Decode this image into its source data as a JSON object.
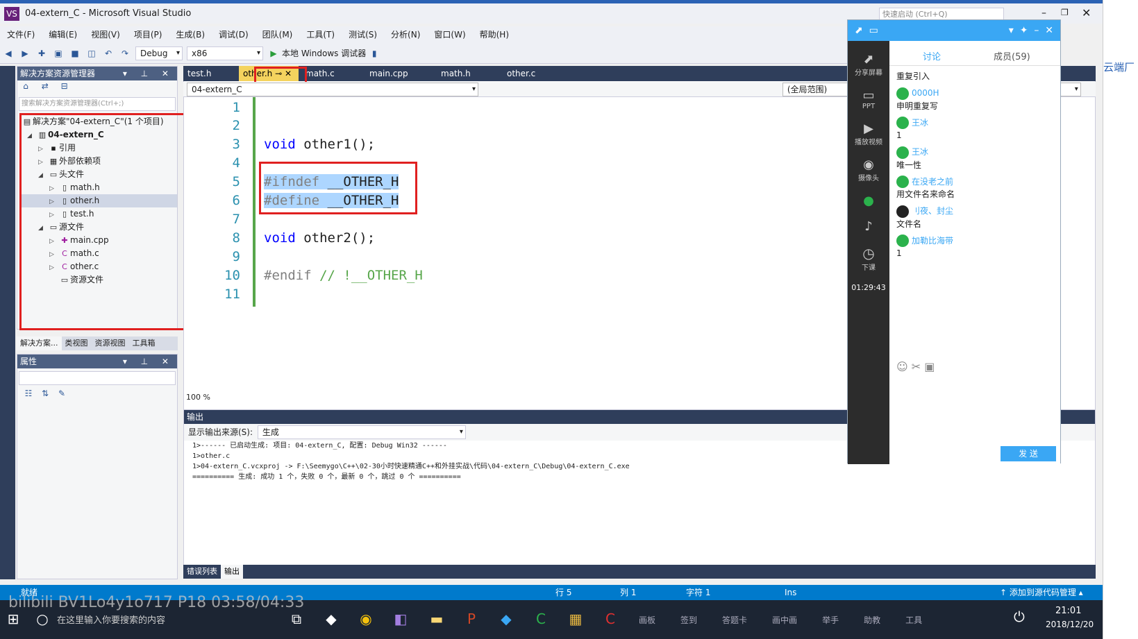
{
  "window": {
    "title": "04-extern_C - Microsoft Visual Studio",
    "quick_launch": "快速启动 (Ctrl+Q)"
  },
  "menu": [
    "文件(F)",
    "编辑(E)",
    "视图(V)",
    "项目(P)",
    "生成(B)",
    "调试(D)",
    "团队(M)",
    "工具(T)",
    "测试(S)",
    "分析(N)",
    "窗口(W)",
    "帮助(H)"
  ],
  "toolbar": {
    "config": "Debug",
    "platform": "x86",
    "run": "本地 Windows 调试器"
  },
  "solution": {
    "header": "解决方案资源管理器",
    "search": "搜索解决方案资源管理器(Ctrl+;)",
    "items": [
      "解决方案\"04-extern_C\"(1 个项目)",
      "04-extern_C",
      "引用",
      "外部依赖项",
      "头文件",
      "math.h",
      "other.h",
      "test.h",
      "源文件",
      "main.cpp",
      "math.c",
      "other.c",
      "资源文件"
    ],
    "tabs": [
      "解决方案...",
      "类视图",
      "资源视图",
      "工具箱"
    ]
  },
  "props": {
    "header": "属性"
  },
  "editor": {
    "tabs": [
      "test.h",
      "other.h",
      "math.c",
      "main.cpp",
      "math.h",
      "other.c"
    ],
    "nav_left": "04-extern_C",
    "nav_right": "(全局范围)",
    "zoom": "100 %",
    "lines": [
      "1",
      "2",
      "3",
      "4",
      "5",
      "6",
      "7",
      "8",
      "9",
      "10",
      "11"
    ],
    "code": {
      "l3a": "void",
      "l3b": " other1();",
      "l5a": "#ifndef",
      "l5b": " __OTHER_H",
      "l6a": "#define",
      "l6b": " __OTHER_H",
      "l8a": "void",
      "l8b": " other2();",
      "l10a": "#endif",
      "l10b": " // !__OTHER_H"
    }
  },
  "output": {
    "header": "输出",
    "source_label": "显示输出来源(S):",
    "source": "生成",
    "lines": [
      "1>------ 已启动生成: 项目: 04-extern_C, 配置: Debug Win32 ------",
      "1>other.c",
      "1>04-extern_C.vcxproj -> F:\\Seemygo\\C++\\02-30小时快速精通C++和外挂实战\\代码\\04-extern_C\\Debug\\04-extern_C.exe",
      "========== 生成: 成功 1 个，失败 0 个，最新 0 个，跳过 0 个 =========="
    ],
    "tabs": [
      "错误列表",
      "输出"
    ]
  },
  "status": {
    "ready": "就绪",
    "row": "行 5",
    "col": "列 1",
    "char": "字符 1",
    "ins": "Ins",
    "publish": "↑ 添加到源代码管理 ▴"
  },
  "taskbar": {
    "search": "在这里输入你要搜索的内容",
    "time": "21:01",
    "date": "2018/12/20",
    "tools": [
      "画板",
      "签到",
      "答题卡",
      "画中画",
      "举手",
      "助教",
      "工具"
    ]
  },
  "qq": {
    "tab_discuss": "讨论",
    "tab_members": "成员(59)",
    "side": [
      "分享屏幕",
      "PPT",
      "播放视频",
      "摄像头",
      "下课"
    ],
    "timer": "01:29:43",
    "send": "发 送",
    "messages": [
      {
        "nick": "",
        "text": "重复引入"
      },
      {
        "nick": "0000H",
        "text": "申明重复写"
      },
      {
        "nick": "王冰",
        "text": "1"
      },
      {
        "nick": "王冰",
        "text": "唯一性"
      },
      {
        "nick": "在没老之前",
        "text": "用文件名来命名"
      },
      {
        "nick": "刂夜、封尘",
        "text": "文件名"
      },
      {
        "nick": "加勒比海带",
        "text": "1"
      }
    ]
  },
  "right_edge": {
    "text": "云端厂"
  },
  "watermark": "bilibili BV1Lo4y1o717 P18 03:58/04:33"
}
